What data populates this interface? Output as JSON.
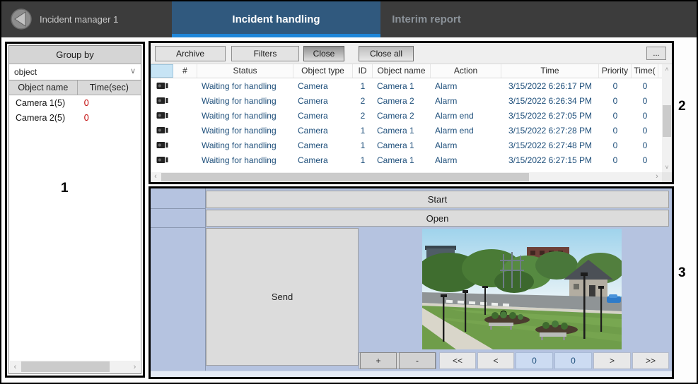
{
  "titlebar": {
    "app_title": "Incident manager 1",
    "tab_incident_handling": "Incident handling",
    "tab_interim_report": "Interim report"
  },
  "annotations": {
    "label1": "1",
    "label2": "2",
    "label3": "3"
  },
  "icons": {
    "chevron_left": "‹",
    "chevron_right": "›",
    "chevron_up": "˄",
    "chevron_down": "˅",
    "combo_chevron": "∨"
  },
  "group_panel": {
    "header": "Group by",
    "dropdown_value": "object",
    "col_object_name": "Object name",
    "col_time": "Time(sec)",
    "rows": [
      {
        "name": "Camera 1(5)",
        "time": "0"
      },
      {
        "name": "Camera 2(5)",
        "time": "0"
      }
    ]
  },
  "incident_panel": {
    "toolbar": {
      "archive": "Archive",
      "filters": "Filters",
      "close": "Close",
      "close_all": "Close all",
      "more": "..."
    },
    "columns": {
      "num": "#",
      "status": "Status",
      "object_type": "Object type",
      "id": "ID",
      "object_name": "Object name",
      "action": "Action",
      "time": "Time",
      "priority": "Priority",
      "time2": "Time("
    },
    "rows": [
      {
        "status": "Waiting for handling",
        "object_type": "Camera",
        "id": "1",
        "object_name": "Camera 1",
        "action": "Alarm",
        "time": "3/15/2022 6:26:17 PM",
        "priority": "0",
        "time2": "0"
      },
      {
        "status": "Waiting for handling",
        "object_type": "Camera",
        "id": "2",
        "object_name": "Camera 2",
        "action": "Alarm",
        "time": "3/15/2022 6:26:34 PM",
        "priority": "0",
        "time2": "0"
      },
      {
        "status": "Waiting for handling",
        "object_type": "Camera",
        "id": "2",
        "object_name": "Camera 2",
        "action": "Alarm end",
        "time": "3/15/2022 6:27:05 PM",
        "priority": "0",
        "time2": "0"
      },
      {
        "status": "Waiting for handling",
        "object_type": "Camera",
        "id": "1",
        "object_name": "Camera 1",
        "action": "Alarm end",
        "time": "3/15/2022 6:27:28 PM",
        "priority": "0",
        "time2": "0"
      },
      {
        "status": "Waiting for handling",
        "object_type": "Camera",
        "id": "1",
        "object_name": "Camera 1",
        "action": "Alarm",
        "time": "3/15/2022 6:27:48 PM",
        "priority": "0",
        "time2": "0"
      },
      {
        "status": "Waiting for handling",
        "object_type": "Camera",
        "id": "1",
        "object_name": "Camera 1",
        "action": "Alarm",
        "time": "3/15/2022 6:27:15 PM",
        "priority": "0",
        "time2": "0"
      }
    ]
  },
  "action_panel": {
    "start": "Start",
    "open": "Open",
    "send": "Send",
    "zoom_in": "+",
    "zoom_out": "-",
    "first": "<<",
    "prev": "<",
    "val1": "0",
    "val2": "0",
    "next": ">",
    "last": ">>"
  },
  "colors": {
    "topbar_bg": "#3c3c3c",
    "active_tab_bg": "#30597e",
    "accent_blue": "#1e86d9",
    "panel_blue": "#b5c3e0",
    "row_text_navy": "#1d4e7a",
    "alert_red": "#c00000"
  }
}
